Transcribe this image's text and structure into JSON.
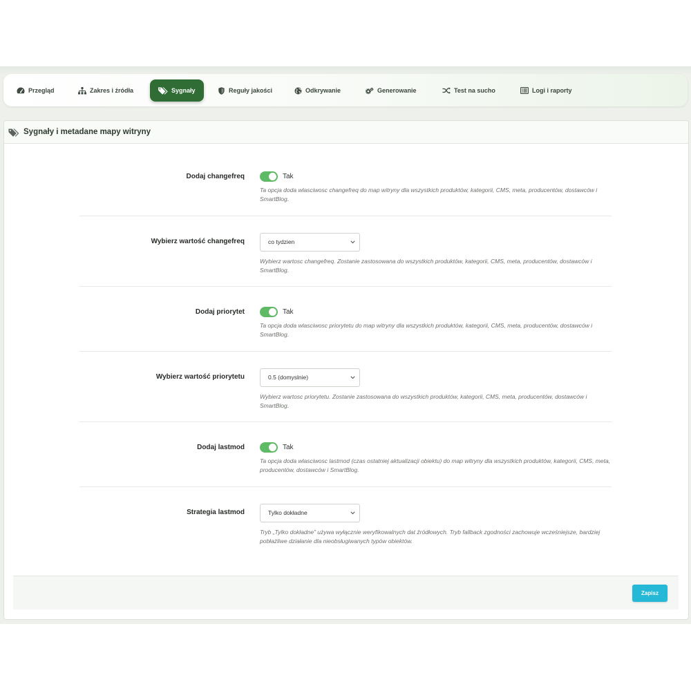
{
  "nav": {
    "tabs": [
      {
        "label": "Przegląd",
        "icon": "dashboard-icon",
        "active": false
      },
      {
        "label": "Zakres i źródła",
        "icon": "sitemap-icon",
        "active": false
      },
      {
        "label": "Sygnały",
        "icon": "tags-icon",
        "active": true
      },
      {
        "label": "Reguły jakości",
        "icon": "shield-icon",
        "active": false
      },
      {
        "label": "Odkrywanie",
        "icon": "globe-icon",
        "active": false
      },
      {
        "label": "Generowanie",
        "icon": "cogs-icon",
        "active": false
      },
      {
        "label": "Test na sucho",
        "icon": "shuffle-icon",
        "active": false
      },
      {
        "label": "Logi i raporty",
        "icon": "list-icon",
        "active": false
      }
    ]
  },
  "panel": {
    "title": "Sygnały i metadane mapy witryny",
    "icon": "tags-icon"
  },
  "form": {
    "rows": [
      {
        "label": "Dodaj changefreq",
        "switch_on": true,
        "switch_label": "Tak",
        "help": "Ta opcja doda wlasciwosc changefreq do map witryny dla wszystkich produktów, kategorii, CMS, meta, producentów, dostawców i SmartBlog."
      },
      {
        "label": "Wybierz wartość changefreq",
        "selected": "co tydzien",
        "help": "Wybierz wartosc changefreq. Zostanie zastosowana do wszystkich produktów, kategorii, CMS, meta, producentów, dostawców i SmartBlog."
      },
      {
        "label": "Dodaj priorytet",
        "switch_on": true,
        "switch_label": "Tak",
        "help": "Ta opcja doda wlasciwosc priorytetu do map witryny dla wszystkich produktów, kategorii, CMS, meta, producentów, dostawców i SmartBlog."
      },
      {
        "label": "Wybierz wartość priorytetu",
        "selected": "0.5 (domyslnie)",
        "help": "Wybierz wartosc priorytetu. Zostanie zastosowana do wszystkich produktów, kategorii, CMS, meta, producentów, dostawców i SmartBlog."
      },
      {
        "label": "Dodaj lastmod",
        "switch_on": true,
        "switch_label": "Tak",
        "help": "Ta opcja doda wlasciwosc lastmod (czas ostatniej aktualizacji obiektu) do map witryny dla wszystkich produktów, kategorii, CMS, meta, producentów, dostawców i SmartBlog."
      },
      {
        "label": "Strategia lastmod",
        "selected": "Tylko dokładne",
        "help": "Tryb „Tylko dokładne” używa wyłącznie weryfikowalnych dat źródłowych. Tryb fallback zgodności zachowuje wcześniejsze, bardziej pobłażliwe działanie dla nieobsługiwanych typów obiektów."
      }
    ]
  },
  "footer": {
    "save_label": "Zapisz"
  },
  "colors": {
    "active_tab": "#2f6d35",
    "switch_on": "#5fba66",
    "save_button": "#25b9d7",
    "page_bg": "#eef0ec"
  }
}
